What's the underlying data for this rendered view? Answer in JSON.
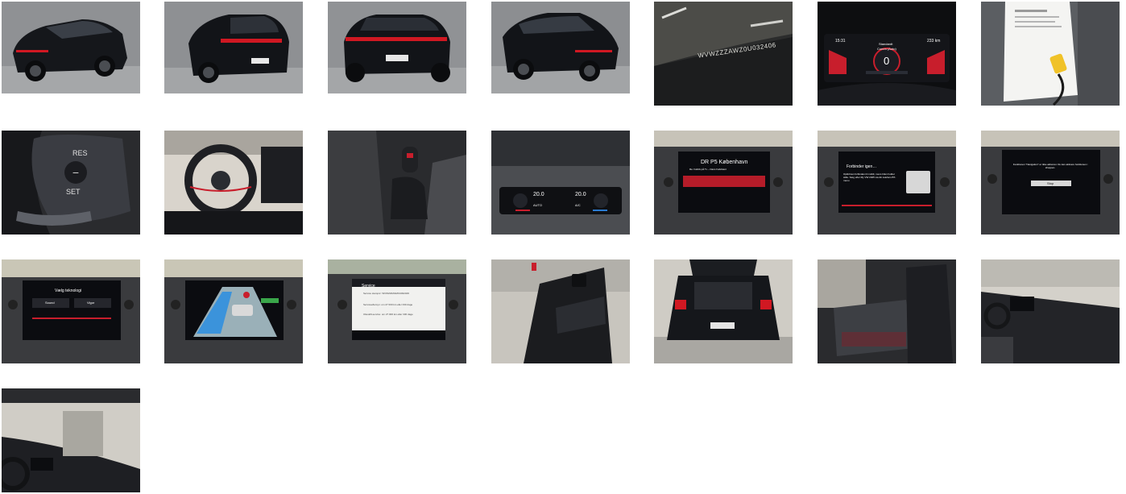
{
  "gallery": {
    "photos": [
      {
        "subject": "car-front-left"
      },
      {
        "subject": "car-rear-left"
      },
      {
        "subject": "car-rear"
      },
      {
        "subject": "car-front-right"
      },
      {
        "subject": "vin-plate",
        "vin_text": "WVWZZZAWZ0U032406"
      },
      {
        "subject": "instrument-cluster",
        "cluster_left": "15:31",
        "cluster_right": "233 km",
        "cluster_center_top": "Standardt",
        "cluster_center_bottom": "Comm (Auto)",
        "cluster_gauge": "0"
      },
      {
        "subject": "service-document"
      },
      {
        "subject": "steering-wheel-buttons",
        "res_label": "RES",
        "set_label": "SET"
      },
      {
        "subject": "cockpit"
      },
      {
        "subject": "gear-shifter"
      },
      {
        "subject": "climate-control",
        "temp_left": "20.0",
        "temp_right": "20.0",
        "mode_left": "AUTO",
        "mode_right": "A/C"
      },
      {
        "subject": "radio-screen",
        "station": "DR P5 København",
        "subtitle": "Re: Fabrik på Tv – Dans Fabrikant"
      },
      {
        "subject": "phone-screen",
        "heading": "Forbinder igen…",
        "body": "Opkld kan forbindes til mobilt, mens bilen holder stille. Sæg efter My VW 2405 via din telefons BT-menu"
      },
      {
        "subject": "navigation-screen",
        "message": "Funktionen \"Navigation\" er ikke aktiveret. Du kan aktivere funktionen i shoppen.",
        "button": "Stop"
      },
      {
        "subject": "menu-screen",
        "heading": "Vælg teknologi",
        "left_option": "Sound",
        "right_option": "Vigor"
      },
      {
        "subject": "lane-assist-screen"
      },
      {
        "subject": "service-screen",
        "title": "Service",
        "line1": "Service stampnr: WVWZZZAWZ0U032406",
        "line2": "Serviceeftersyn: om 27 000 km eller 330 dage",
        "line3": "Olieskift-service: om 27 000 km eller 330 dage"
      },
      {
        "subject": "driver-door"
      },
      {
        "subject": "open-trunk"
      },
      {
        "subject": "rear-seats"
      },
      {
        "subject": "dashboard-passenger-side"
      },
      {
        "subject": "dashboard-wide"
      }
    ]
  },
  "colors": {
    "studio_bg": "#9a9c9e",
    "car_black": "#121418",
    "tail_red": "#d01822",
    "screen_bg": "#0b0c10",
    "screen_red": "#c81e2c",
    "interior_dark": "#23252a"
  }
}
